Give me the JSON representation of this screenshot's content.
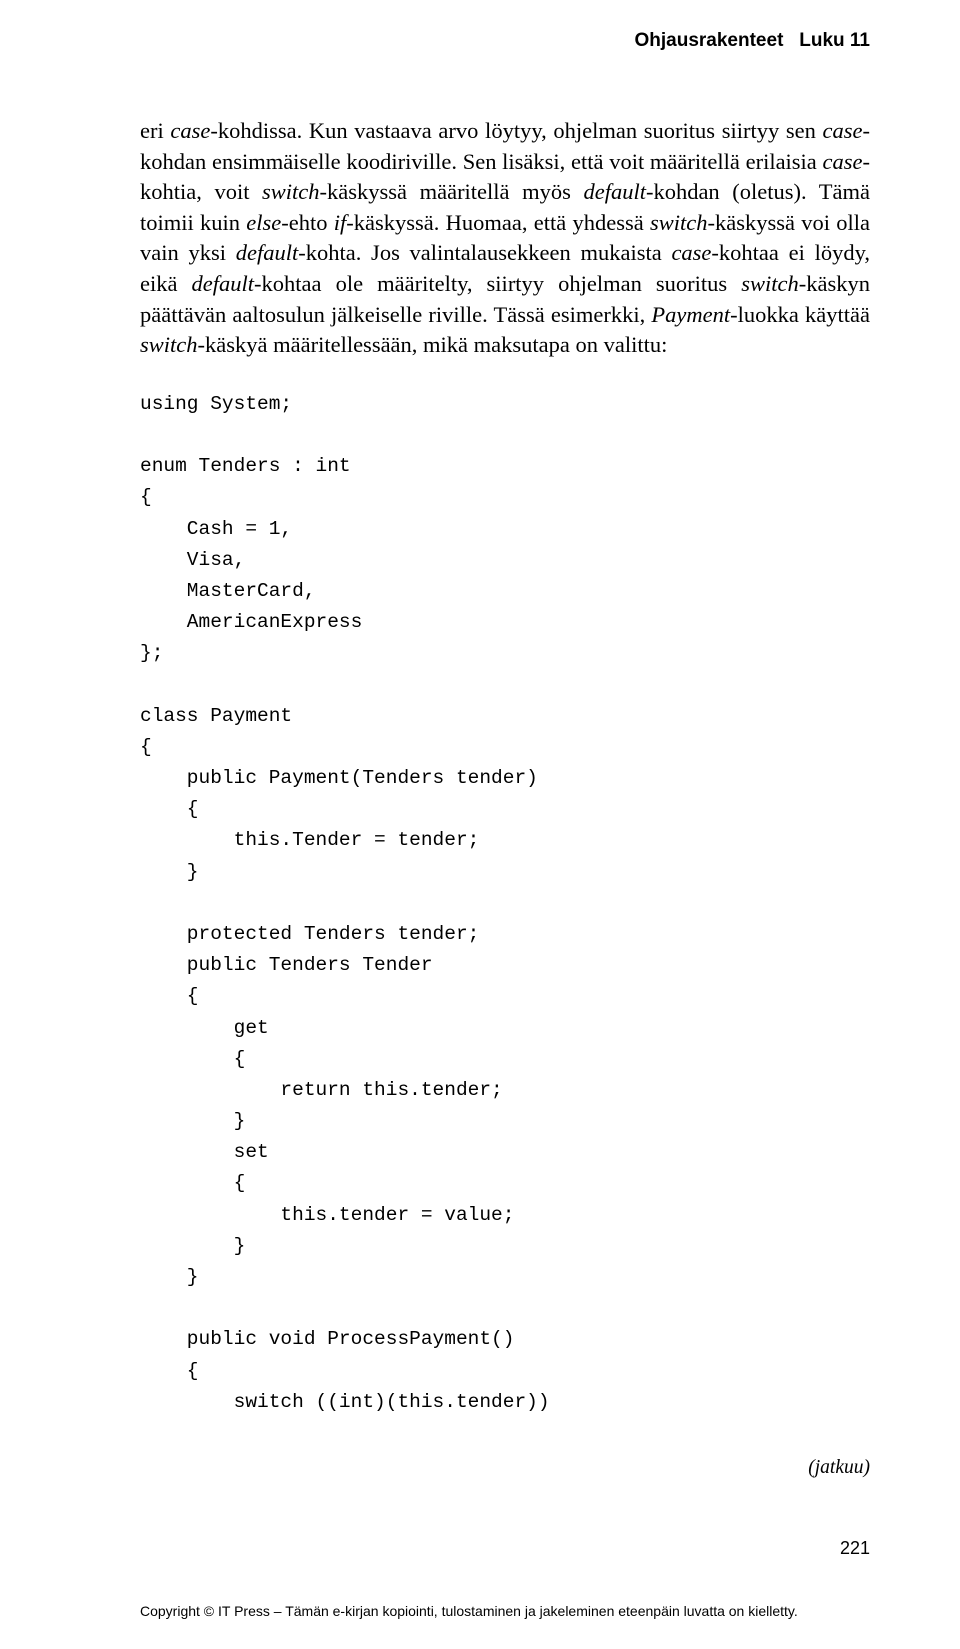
{
  "header": {
    "chapterTitle": "Ohjausrakenteet",
    "chapterLabel": "Luku 11"
  },
  "paragraphs": {
    "p1": {
      "s1a": "eri ",
      "s1b": "case",
      "s1c": "-kohdissa. Kun vastaava arvo löytyy, ohjelman suoritus siirtyy sen ",
      "s1d": "case",
      "s1e": "-kohdan ensimmäiselle koodiriville. Sen lisäksi, että voit määritellä erilaisia ",
      "s1f": "case",
      "s1g": "-kohtia, voit ",
      "s1h": "switch",
      "s1i": "-käskyssä määritellä myös ",
      "s1j": "default",
      "s1k": "-kohdan (oletus). Tämä toimii kuin ",
      "s1l": "else",
      "s1m": "-ehto ",
      "s1n": "if",
      "s1o": "-käskyssä. Huomaa, että yhdessä ",
      "s1p": "switch",
      "s1q": "-käskyssä voi olla vain yksi ",
      "s1r": "default",
      "s1s": "-kohta. Jos valintalausekkeen mukaista ",
      "s1t": "case",
      "s1u": "-kohtaa ei löydy, eikä ",
      "s1v": "default",
      "s1w": "-kohtaa ole määritelty, siirtyy ohjelman suoritus ",
      "s1x": "switch",
      "s1y": "-käskyn päättävän aaltosulun jälkeiselle riville. Tässä esimerkki, ",
      "s1z": "Payment",
      "s1aa": "-luokka käyttää ",
      "s1ab": "switch",
      "s1ac": "-käskyä määritellessään, mikä maksutapa on valittu:"
    }
  },
  "code": {
    "block1": "using System;\n\nenum Tenders : int\n{\n    Cash = 1,\n    Visa,\n    MasterCard,\n    AmericanExpress\n};\n\nclass Payment\n{\n    public Payment(Tenders tender)\n    {\n        this.Tender = tender;\n    }\n\n    protected Tenders tender;\n    public Tenders Tender\n    {\n        get\n        {\n            return this.tender;\n        }\n        set\n        {\n            this.tender = value;\n        }\n    }\n\n    public void ProcessPayment()\n    {\n        switch ((int)(this.tender))"
  },
  "footnote": "(jatkuu)",
  "pageNumber": "221",
  "copyright": "Copyright © IT Press – Tämän e-kirjan kopiointi, tulostaminen ja jakeleminen eteenpäin luvatta on kielletty."
}
